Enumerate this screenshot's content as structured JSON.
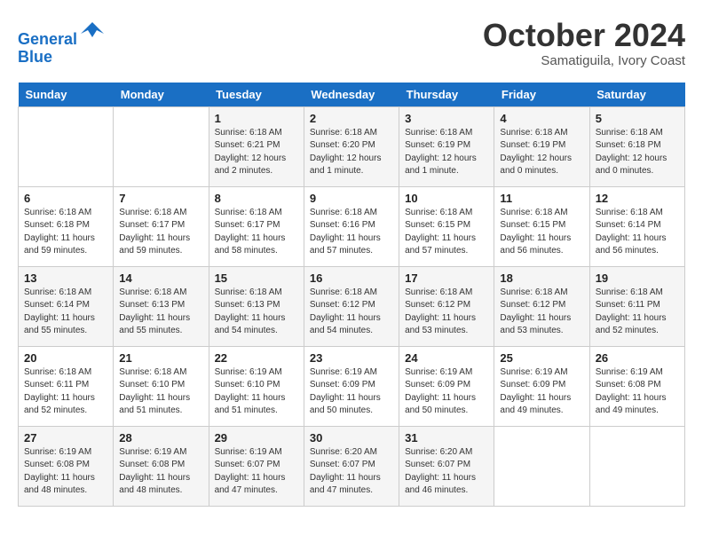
{
  "header": {
    "logo_line1": "General",
    "logo_line2": "Blue",
    "month": "October 2024",
    "location": "Samatiguila, Ivory Coast"
  },
  "weekdays": [
    "Sunday",
    "Monday",
    "Tuesday",
    "Wednesday",
    "Thursday",
    "Friday",
    "Saturday"
  ],
  "rows": [
    [
      {
        "day": "",
        "info": ""
      },
      {
        "day": "",
        "info": ""
      },
      {
        "day": "1",
        "info": "Sunrise: 6:18 AM\nSunset: 6:21 PM\nDaylight: 12 hours\nand 2 minutes."
      },
      {
        "day": "2",
        "info": "Sunrise: 6:18 AM\nSunset: 6:20 PM\nDaylight: 12 hours\nand 1 minute."
      },
      {
        "day": "3",
        "info": "Sunrise: 6:18 AM\nSunset: 6:19 PM\nDaylight: 12 hours\nand 1 minute."
      },
      {
        "day": "4",
        "info": "Sunrise: 6:18 AM\nSunset: 6:19 PM\nDaylight: 12 hours\nand 0 minutes."
      },
      {
        "day": "5",
        "info": "Sunrise: 6:18 AM\nSunset: 6:18 PM\nDaylight: 12 hours\nand 0 minutes."
      }
    ],
    [
      {
        "day": "6",
        "info": "Sunrise: 6:18 AM\nSunset: 6:18 PM\nDaylight: 11 hours\nand 59 minutes."
      },
      {
        "day": "7",
        "info": "Sunrise: 6:18 AM\nSunset: 6:17 PM\nDaylight: 11 hours\nand 59 minutes."
      },
      {
        "day": "8",
        "info": "Sunrise: 6:18 AM\nSunset: 6:17 PM\nDaylight: 11 hours\nand 58 minutes."
      },
      {
        "day": "9",
        "info": "Sunrise: 6:18 AM\nSunset: 6:16 PM\nDaylight: 11 hours\nand 57 minutes."
      },
      {
        "day": "10",
        "info": "Sunrise: 6:18 AM\nSunset: 6:15 PM\nDaylight: 11 hours\nand 57 minutes."
      },
      {
        "day": "11",
        "info": "Sunrise: 6:18 AM\nSunset: 6:15 PM\nDaylight: 11 hours\nand 56 minutes."
      },
      {
        "day": "12",
        "info": "Sunrise: 6:18 AM\nSunset: 6:14 PM\nDaylight: 11 hours\nand 56 minutes."
      }
    ],
    [
      {
        "day": "13",
        "info": "Sunrise: 6:18 AM\nSunset: 6:14 PM\nDaylight: 11 hours\nand 55 minutes."
      },
      {
        "day": "14",
        "info": "Sunrise: 6:18 AM\nSunset: 6:13 PM\nDaylight: 11 hours\nand 55 minutes."
      },
      {
        "day": "15",
        "info": "Sunrise: 6:18 AM\nSunset: 6:13 PM\nDaylight: 11 hours\nand 54 minutes."
      },
      {
        "day": "16",
        "info": "Sunrise: 6:18 AM\nSunset: 6:12 PM\nDaylight: 11 hours\nand 54 minutes."
      },
      {
        "day": "17",
        "info": "Sunrise: 6:18 AM\nSunset: 6:12 PM\nDaylight: 11 hours\nand 53 minutes."
      },
      {
        "day": "18",
        "info": "Sunrise: 6:18 AM\nSunset: 6:12 PM\nDaylight: 11 hours\nand 53 minutes."
      },
      {
        "day": "19",
        "info": "Sunrise: 6:18 AM\nSunset: 6:11 PM\nDaylight: 11 hours\nand 52 minutes."
      }
    ],
    [
      {
        "day": "20",
        "info": "Sunrise: 6:18 AM\nSunset: 6:11 PM\nDaylight: 11 hours\nand 52 minutes."
      },
      {
        "day": "21",
        "info": "Sunrise: 6:18 AM\nSunset: 6:10 PM\nDaylight: 11 hours\nand 51 minutes."
      },
      {
        "day": "22",
        "info": "Sunrise: 6:19 AM\nSunset: 6:10 PM\nDaylight: 11 hours\nand 51 minutes."
      },
      {
        "day": "23",
        "info": "Sunrise: 6:19 AM\nSunset: 6:09 PM\nDaylight: 11 hours\nand 50 minutes."
      },
      {
        "day": "24",
        "info": "Sunrise: 6:19 AM\nSunset: 6:09 PM\nDaylight: 11 hours\nand 50 minutes."
      },
      {
        "day": "25",
        "info": "Sunrise: 6:19 AM\nSunset: 6:09 PM\nDaylight: 11 hours\nand 49 minutes."
      },
      {
        "day": "26",
        "info": "Sunrise: 6:19 AM\nSunset: 6:08 PM\nDaylight: 11 hours\nand 49 minutes."
      }
    ],
    [
      {
        "day": "27",
        "info": "Sunrise: 6:19 AM\nSunset: 6:08 PM\nDaylight: 11 hours\nand 48 minutes."
      },
      {
        "day": "28",
        "info": "Sunrise: 6:19 AM\nSunset: 6:08 PM\nDaylight: 11 hours\nand 48 minutes."
      },
      {
        "day": "29",
        "info": "Sunrise: 6:19 AM\nSunset: 6:07 PM\nDaylight: 11 hours\nand 47 minutes."
      },
      {
        "day": "30",
        "info": "Sunrise: 6:20 AM\nSunset: 6:07 PM\nDaylight: 11 hours\nand 47 minutes."
      },
      {
        "day": "31",
        "info": "Sunrise: 6:20 AM\nSunset: 6:07 PM\nDaylight: 11 hours\nand 46 minutes."
      },
      {
        "day": "",
        "info": ""
      },
      {
        "day": "",
        "info": ""
      }
    ]
  ]
}
